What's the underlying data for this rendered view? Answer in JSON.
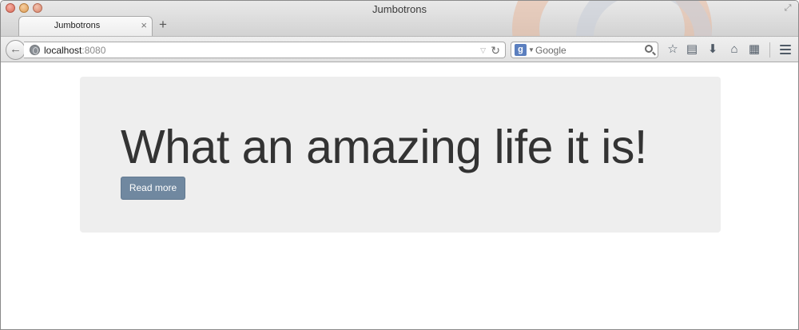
{
  "window": {
    "title": "Jumbotrons"
  },
  "tabs": [
    {
      "label": "Jumbotrons",
      "close": "×"
    }
  ],
  "new_tab_label": "+",
  "navbar": {
    "url_host": "localhost",
    "url_port": ":8080",
    "search_placeholder": "Google",
    "search_engine_glyph": "g"
  },
  "page": {
    "jumbotron": {
      "heading": "What an amazing life it is!",
      "button_label": "Read more"
    }
  },
  "colors": {
    "jumbotron_bg": "#eeeeee",
    "heading_text": "#333333",
    "button_bg": "#7088a0",
    "button_text": "#ffffff"
  }
}
